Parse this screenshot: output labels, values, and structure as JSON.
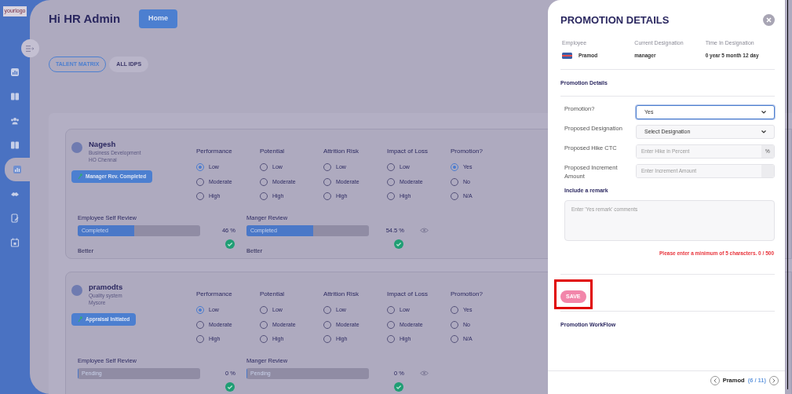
{
  "sidebar": {
    "logo": "yourlogo",
    "items": [
      {
        "selected": false
      },
      {
        "selected": false
      },
      {
        "selected": false
      },
      {
        "selected": false
      },
      {
        "selected": true
      },
      {
        "selected": false
      },
      {
        "selected": false
      },
      {
        "selected": false
      }
    ]
  },
  "header": {
    "greeting": "Hi HR Admin",
    "home_button": "Home"
  },
  "tabs": [
    {
      "label": "TALENT MATRIX",
      "selected": true
    },
    {
      "label": "ALL IDPS",
      "selected": false
    }
  ],
  "employees": [
    {
      "name": "Nagesh",
      "department": "Business Development",
      "location": "HO Chennai",
      "status": "Manager Rev. Completed",
      "ratings": [
        {
          "label": "Performance",
          "options": [
            {
              "label": "Low",
              "selected": true
            },
            {
              "label": "Moderate",
              "selected": false
            },
            {
              "label": "High",
              "selected": false
            }
          ]
        },
        {
          "label": "Potential",
          "options": [
            {
              "label": "Low",
              "selected": false
            },
            {
              "label": "Moderate",
              "selected": false
            },
            {
              "label": "High",
              "selected": false
            }
          ]
        },
        {
          "label": "Attrition Risk",
          "options": [
            {
              "label": "Low",
              "selected": false
            },
            {
              "label": "Moderate",
              "selected": false
            },
            {
              "label": "High",
              "selected": false
            }
          ]
        },
        {
          "label": "Impact of Loss",
          "options": [
            {
              "label": "Low",
              "selected": false
            },
            {
              "label": "Moderate",
              "selected": false
            },
            {
              "label": "High",
              "selected": false
            }
          ]
        },
        {
          "label": "Promotion?",
          "options": [
            {
              "label": "Yes",
              "selected": true
            },
            {
              "label": "No",
              "selected": false
            },
            {
              "label": "N/A",
              "selected": false
            }
          ]
        }
      ],
      "reviews": [
        {
          "title": "Employee Self Review",
          "status": "Completed",
          "level": 0.46,
          "percent": "46 %",
          "grade": "Better"
        },
        {
          "title": "Manger Review",
          "status": "Completed",
          "level": 0.545,
          "percent": "54.5 %",
          "grade": "Better"
        }
      ]
    },
    {
      "name": "pramodts",
      "department": "Quality system",
      "location": "Mysore",
      "status": "Appraisal Initiated",
      "ratings": [
        {
          "label": "Performance",
          "options": [
            {
              "label": "Low",
              "selected": true
            },
            {
              "label": "Moderate",
              "selected": false
            },
            {
              "label": "High",
              "selected": false
            }
          ]
        },
        {
          "label": "Potential",
          "options": [
            {
              "label": "Low",
              "selected": false
            },
            {
              "label": "Moderate",
              "selected": false
            },
            {
              "label": "High",
              "selected": false
            }
          ]
        },
        {
          "label": "Attrition Risk",
          "options": [
            {
              "label": "Low",
              "selected": false
            },
            {
              "label": "Moderate",
              "selected": false
            },
            {
              "label": "High",
              "selected": false
            }
          ]
        },
        {
          "label": "Impact of Loss",
          "options": [
            {
              "label": "Low",
              "selected": false
            },
            {
              "label": "Moderate",
              "selected": false
            },
            {
              "label": "High",
              "selected": false
            }
          ]
        },
        {
          "label": "Promotion?",
          "options": [
            {
              "label": "Yes",
              "selected": false
            },
            {
              "label": "No",
              "selected": false
            },
            {
              "label": "N/A",
              "selected": false
            }
          ]
        }
      ],
      "reviews": [
        {
          "title": "Employee Self Review",
          "status": "Pending",
          "level": 0,
          "percent": "0 %"
        },
        {
          "title": "Manger Review",
          "status": "Pending",
          "level": 0,
          "percent": "0 %"
        }
      ]
    }
  ],
  "drawer": {
    "title": "PROMOTION DETAILS",
    "info": [
      {
        "label": "Employee",
        "value": "Pramod"
      },
      {
        "label": "Current Designation",
        "value": "manager"
      },
      {
        "label": "Time In Designation",
        "value": "0 year 5 month 12 day"
      }
    ],
    "section_title": "Promotion Details",
    "fields": [
      {
        "kind": "select",
        "label": "Promotion?",
        "value": "Yes",
        "focused": true
      },
      {
        "kind": "select",
        "label": "Proposed Designation",
        "value": "Select Designation",
        "focused": false
      },
      {
        "kind": "addon",
        "label": "Proposed Hike CTC",
        "placeholder": "Enter Hike in Percent",
        "addon": "%"
      },
      {
        "kind": "addon",
        "label": "Proposed Increment Amount",
        "placeholder": "Enter Increment Amount"
      }
    ],
    "remark_label": "Include a remark",
    "remark_placeholder": "Enter 'Yes remark' comments",
    "error": "Please enter a minimum of 5 characters. 0 / 500",
    "save_button": "SAVE",
    "save_highlighted": true,
    "workflow_title": "Promotion WorkFlow",
    "pager": {
      "name": "Pramod",
      "counter": "(6 / 11)"
    }
  }
}
